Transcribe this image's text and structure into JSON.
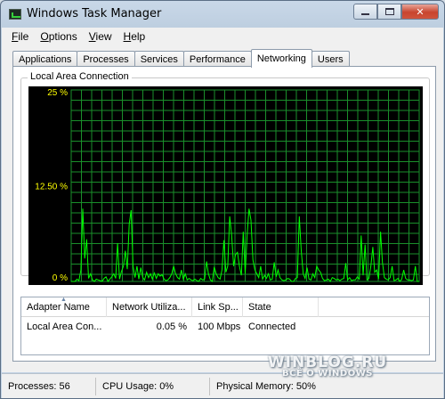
{
  "window": {
    "title": "Windows Task Manager"
  },
  "menu": [
    {
      "mnemonic": "F",
      "rest": "ile"
    },
    {
      "mnemonic": "O",
      "rest": "ptions"
    },
    {
      "mnemonic": "V",
      "rest": "iew"
    },
    {
      "mnemonic": "H",
      "rest": "elp"
    }
  ],
  "tabs": [
    "Applications",
    "Processes",
    "Services",
    "Performance",
    "Networking",
    "Users"
  ],
  "active_tab": "Networking",
  "graph": {
    "group_label": "Local Area Connection",
    "y_labels": [
      "25 %",
      "12.50 %",
      "0 %"
    ],
    "grid_color": "#1a8f2b",
    "line_color": "#00ff00",
    "axis_label_color": "#ffff00"
  },
  "chart_data": {
    "type": "line",
    "ylim": [
      0,
      25
    ],
    "series": [
      {
        "values": [
          0,
          0,
          0,
          0.3,
          0.1,
          1.5,
          9.5,
          3.0,
          5.5,
          0.4,
          1.0,
          0.2,
          0,
          0.3,
          0.2,
          0.1,
          0,
          0.4,
          0.6,
          0,
          0.3,
          0.6,
          1.0,
          0.4,
          5.0,
          0.3,
          1.3,
          2.0,
          4.0,
          1.6,
          7.5,
          9.3,
          2.0,
          0.5,
          2.0,
          0.3,
          1.8,
          0.5,
          0.2,
          1.2,
          0.5,
          1.0,
          0.3,
          1.1,
          0.4,
          1.0,
          0.7,
          0.9,
          0.3,
          0.1,
          0.2,
          0.5,
          1.0,
          2.0,
          1.0,
          0.5,
          0.3,
          1.5,
          0.3,
          1.0,
          0.2,
          0.4,
          0.2,
          0.1,
          0.3,
          0.1,
          0,
          0.4,
          0.2,
          0.3,
          2.6,
          1.0,
          0.2,
          0,
          1.9,
          1.0,
          0.5,
          0.3,
          1.5,
          5.4,
          1.2,
          2.0,
          8.5,
          6.0,
          2.0,
          3.5,
          3.8,
          2.0,
          0.8,
          6.5,
          1.0,
          6.1,
          9.5,
          8.0,
          2.8,
          1.5,
          1.0,
          0.5,
          2.0,
          0.3,
          0.8,
          0.4,
          1.0,
          0.2,
          0.3,
          2.5,
          0.6,
          1.5,
          0.5,
          0.2,
          0.1,
          0.2,
          0.4,
          0.3,
          0,
          0,
          0.4,
          0.5,
          8.5,
          4.0,
          1.0,
          0.4,
          1.8,
          0.3,
          0.2,
          1.0,
          0.5,
          2.0,
          1.5,
          1.2,
          0.4,
          0.1,
          0.2,
          0.3,
          0,
          0.5,
          0.4,
          0.2,
          0.3,
          0.1,
          0.3,
          0.4,
          2.4,
          0.2,
          0.5,
          0.1,
          0.2,
          0.2,
          0.6,
          0.3,
          6.0,
          0.8,
          4.8,
          0.2,
          0.4,
          2.0,
          4.5,
          1.2,
          1.5,
          0.3,
          6.5,
          2.5,
          0.5,
          0.3,
          0.2,
          0.5,
          2.0,
          0.1,
          0.2,
          0.4,
          0,
          0.3,
          1.5,
          0.4,
          0.2,
          0.2,
          0.1,
          0.2,
          2.0,
          0,
          0
        ]
      }
    ]
  },
  "adapters": {
    "columns": [
      "Adapter Name",
      "Network Utiliza...",
      "Link Sp...",
      "State"
    ],
    "rows": [
      {
        "name": "Local Area Con...",
        "utilization": "0.05 %",
        "speed": "100 Mbps",
        "state": "Connected"
      }
    ]
  },
  "status": {
    "processes": "Processes: 56",
    "cpu": "CPU Usage: 0%",
    "memory": "Physical Memory: 50%"
  },
  "watermark": {
    "line1": "WINBLOG.RU",
    "line2": "ВСЁ О WINDOWS"
  }
}
